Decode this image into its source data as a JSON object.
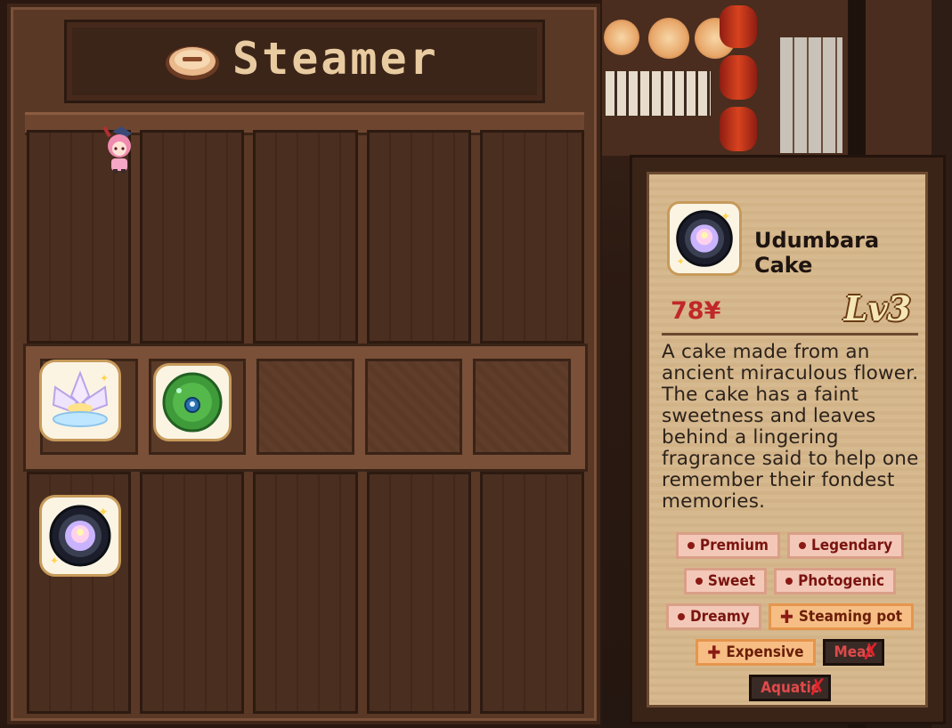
{
  "steamer": {
    "title": "Steamer",
    "icon": "steamer-pot-icon",
    "rows": [
      {
        "slots": [
          "empty",
          "empty",
          "empty",
          "empty",
          "empty"
        ]
      },
      {
        "slots": [
          "lotus-flower-icon",
          "lily-pad-icon",
          "empty",
          "empty",
          "empty"
        ]
      },
      {
        "slots": [
          "udumbara-cake-icon",
          "empty",
          "empty",
          "empty",
          "empty"
        ]
      }
    ]
  },
  "character": {
    "icon": "chibi-character-icon"
  },
  "info_card": {
    "name": "Udumbara Cake",
    "price": "78¥",
    "level": "Lv3",
    "description": "A cake made from an ancient miraculous flower. The cake has a faint sweetness and leaves behind a lingering fragrance said to help one remember their fondest memories.",
    "tags": {
      "row1": [
        "Premium",
        "Legendary"
      ],
      "row2": [
        "Sweet",
        "Photogenic"
      ],
      "row3_trait": "Dreamy",
      "row3_pos": "Steaming pot",
      "row4_pos": "Expensive",
      "row4_neg": "Meat",
      "row5_neg": "Aquatic"
    }
  },
  "colors": {
    "price": "#c0282a",
    "trait_text": "#7a1410",
    "negative_text": "#e04a4a"
  }
}
